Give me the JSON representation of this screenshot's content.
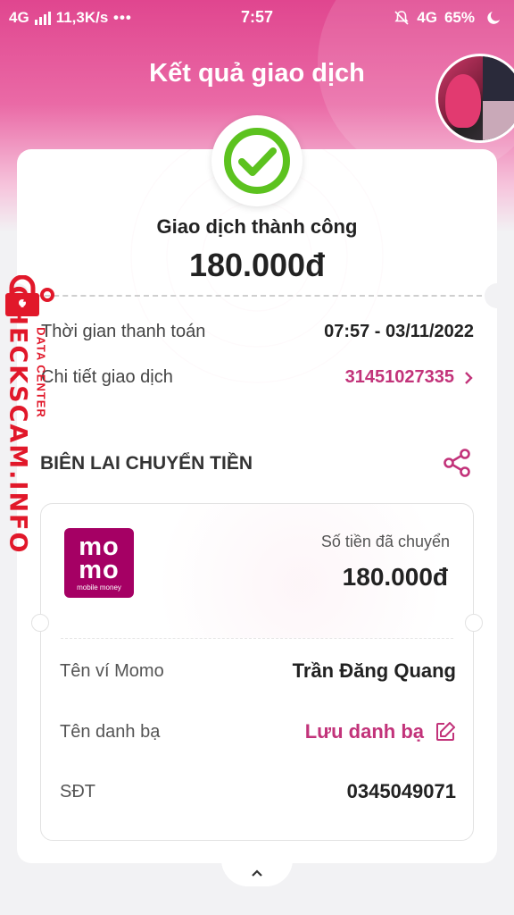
{
  "status_bar": {
    "network": "4G",
    "speed": "11,3K/s",
    "time": "7:57",
    "network_right": "4G",
    "battery": "65%"
  },
  "header": {
    "title": "Kết quả giao dịch"
  },
  "transaction": {
    "status": "Giao dịch thành công",
    "amount": "180.000đ",
    "time_label": "Thời gian thanh toán",
    "time_value": "07:57 - 03/11/2022",
    "detail_label": "Chi tiết giao dịch",
    "detail_value": "31451027335"
  },
  "receipt": {
    "title": "BIÊN LAI CHUYỂN TIỀN",
    "logo_line1": "mo",
    "logo_line2": "mo",
    "logo_sub": "mobile money",
    "sent_label": "Số tiền đã chuyển",
    "sent_amount": "180.000đ",
    "wallet_label": "Tên ví Momo",
    "wallet_value": "Trần Đăng Quang",
    "contact_label": "Tên danh bạ",
    "contact_action": "Lưu danh bạ",
    "phone_label": "SĐT",
    "phone_value": "0345049071"
  },
  "watermark": {
    "text": "CHECKSCAM.INFO",
    "sub": "DATA CENTER"
  },
  "colors": {
    "brand_pink": "#c2337a",
    "momo": "#a50064",
    "success": "#5cc21f"
  }
}
